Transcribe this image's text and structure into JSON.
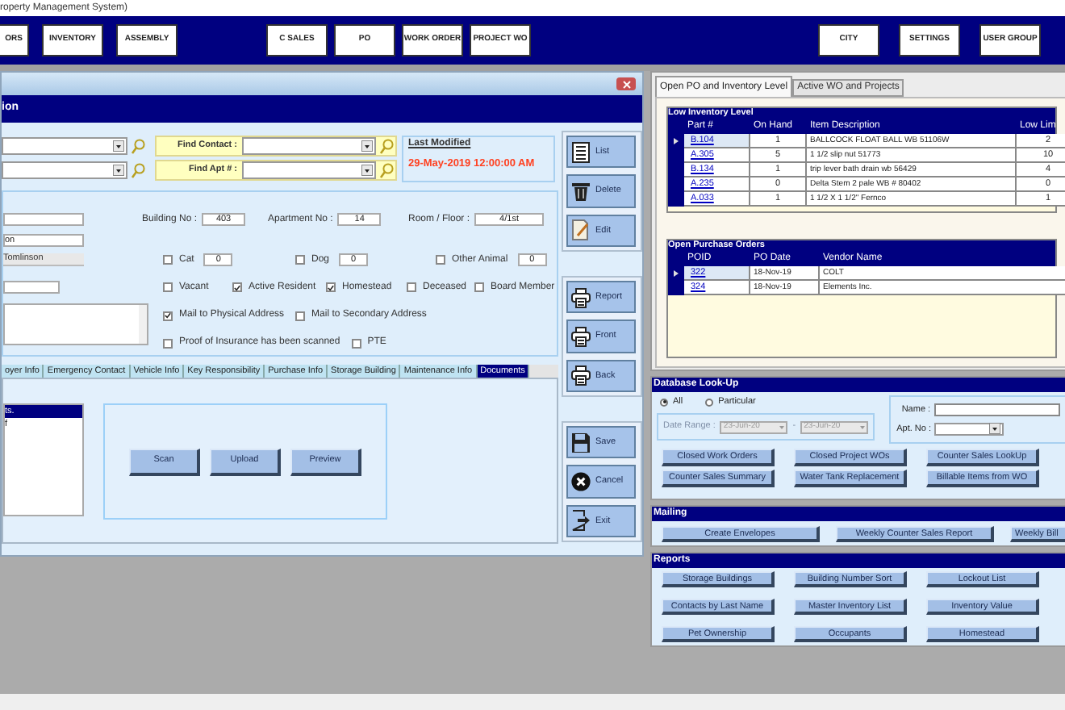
{
  "app_title": "roperty Management System)",
  "nav": {
    "left": [
      "ORS",
      "INVENTORY",
      "ASSEMBLY"
    ],
    "middle": [
      "C SALES",
      "PO",
      "WORK ORDER",
      "PROJECT WO"
    ],
    "right": [
      "CITY",
      "SETTINGS",
      "USER GROUP"
    ]
  },
  "form_window": {
    "header": "ion",
    "finders": [
      {
        "label": "Find Contact :"
      },
      {
        "label": "Find Apt # :"
      }
    ],
    "last_modified": {
      "label": "Last Modified",
      "value": "29-May-2019 12:00:00 AM"
    },
    "left_fields": [
      {
        "kind": "input"
      },
      {
        "kind": "input",
        "value": "on"
      },
      {
        "kind": "readonly",
        "value": "Tomlinson"
      },
      {
        "kind": "input"
      },
      {
        "kind": "textarea"
      }
    ],
    "unit_fields": [
      {
        "label": "Building No :",
        "value": "403"
      },
      {
        "label": "Apartment No :",
        "value": "14"
      },
      {
        "label": "Room / Floor :",
        "value": "4/1st"
      }
    ],
    "animals": [
      {
        "label": "Cat",
        "checked": false,
        "value": "0"
      },
      {
        "label": "Dog",
        "checked": false,
        "value": "0"
      },
      {
        "label": "Other Animal",
        "checked": false,
        "value": "0"
      }
    ],
    "flags": [
      {
        "label": "Vacant",
        "checked": false
      },
      {
        "label": "Active Resident",
        "checked": true
      },
      {
        "label": "Homestead",
        "checked": true
      },
      {
        "label": "Deceased",
        "checked": false
      },
      {
        "label": "Board Member",
        "checked": false
      }
    ],
    "mail": [
      {
        "label": "Mail to Physical Address",
        "checked": true
      },
      {
        "label": "Mail to Secondary Address",
        "checked": false
      }
    ],
    "misc": [
      {
        "label": "Proof of Insurance has been scanned",
        "checked": false
      },
      {
        "label": "PTE",
        "checked": false
      }
    ],
    "tabs": [
      {
        "label": "oyer Info",
        "selected": false
      },
      {
        "label": "Emergency Contact",
        "selected": false
      },
      {
        "label": "Vehicle Info",
        "selected": false
      },
      {
        "label": "Key Responsibility",
        "selected": false
      },
      {
        "label": "Purchase Info",
        "selected": false
      },
      {
        "label": "Storage Building",
        "selected": false
      },
      {
        "label": "Maintenance Info",
        "selected": false
      },
      {
        "label": "Documents",
        "selected": true
      }
    ],
    "documents": {
      "items": [
        {
          "text": "ts.",
          "selected": true
        },
        {
          "text": "f",
          "selected": false
        }
      ],
      "buttons": [
        "Scan",
        "Upload",
        "Preview"
      ]
    },
    "side_buttons": [
      [
        {
          "label": "List",
          "kind": "list"
        },
        {
          "label": "Delete",
          "kind": "delete"
        },
        {
          "label": "Edit",
          "kind": "edit"
        }
      ],
      [
        {
          "label": "Report",
          "kind": "print"
        },
        {
          "label": "Front",
          "kind": "print"
        },
        {
          "label": "Back",
          "kind": "print"
        }
      ],
      [
        {
          "label": "Save",
          "kind": "save"
        },
        {
          "label": "Cancel",
          "kind": "cancel"
        },
        {
          "label": "Exit",
          "kind": "exit"
        }
      ]
    ]
  },
  "right_panel": {
    "tabs": [
      {
        "label": "Open PO and Inventory Level",
        "selected": true
      },
      {
        "label": "Active WO and Projects",
        "selected": false
      }
    ],
    "low_inventory": {
      "title": "Low Inventory Level",
      "columns": [
        "Part #",
        "On Hand",
        "Item Description",
        "Low Lim"
      ],
      "rows": [
        {
          "current": true,
          "cells": [
            "B.104",
            "1",
            "BALLCOCK FLOAT BALL WB 51106W",
            "2"
          ]
        },
        {
          "current": false,
          "cells": [
            "A.305",
            "5",
            "1 1/2 slip nut 51773",
            "10"
          ]
        },
        {
          "current": false,
          "cells": [
            "B.134",
            "1",
            "trip lever bath drain wb 56429",
            "4"
          ]
        },
        {
          "current": false,
          "cells": [
            "A.235",
            "0",
            "Delta Stem 2 pale WB # 80402",
            "0"
          ]
        },
        {
          "current": false,
          "cells": [
            "A.033",
            "1",
            "1 1/2 X 1 1/2\" Fernco",
            "1"
          ]
        }
      ]
    },
    "open_po": {
      "title": "Open Purchase Orders",
      "columns": [
        "POID",
        "PO Date",
        "Vendor Name"
      ],
      "rows": [
        {
          "current": true,
          "cells": [
            "322",
            "18-Nov-19",
            "COLT"
          ]
        },
        {
          "current": false,
          "cells": [
            "324",
            "18-Nov-19",
            "Elements Inc."
          ]
        }
      ]
    },
    "lookup": {
      "title": "Database Look-Up",
      "radios": [
        {
          "label": "All",
          "selected": true
        },
        {
          "label": "Particular",
          "selected": false
        }
      ],
      "date_label": "Date Range :",
      "date_from": "23-Jun-20",
      "separator": "-",
      "date_to": "23-Jun-20",
      "name_label": "Name :",
      "apt_label": "Apt. No :",
      "buttons": [
        "Closed Work Orders",
        "Closed Project WOs",
        "Counter Sales LookUp",
        "Counter Sales Summary",
        "Water Tank Replacement",
        "Billable Items from WO"
      ]
    },
    "mailing": {
      "title": "Mailing",
      "buttons": [
        "Create Envelopes",
        "Weekly Counter Sales Report",
        "Weekly Bill"
      ]
    },
    "reports": {
      "title": "Reports",
      "buttons": [
        "Storage Buildings",
        "Building Number Sort",
        "Lockout List",
        "Contacts by Last Name",
        "Master Inventory List",
        "Inventory Value",
        "Pet Ownership",
        "Occupants",
        "Homestead"
      ]
    }
  }
}
